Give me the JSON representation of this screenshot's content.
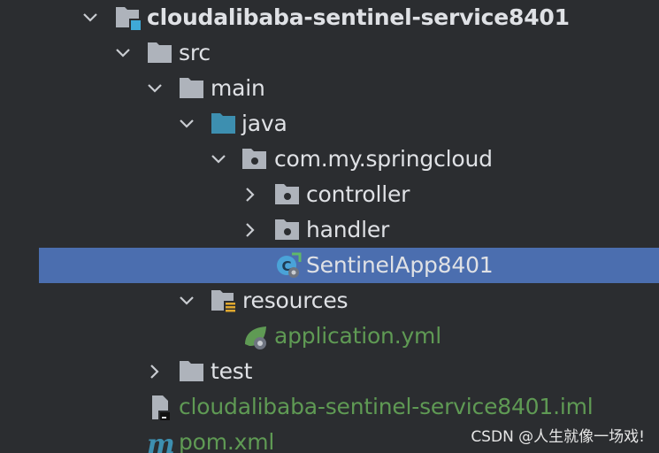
{
  "tree": {
    "items": [
      {
        "name": "cloudalibaba-sentinel-service8401",
        "type": "module",
        "expanded": true
      },
      {
        "name": "src",
        "type": "folder",
        "expanded": true
      },
      {
        "name": "main",
        "type": "folder",
        "expanded": true
      },
      {
        "name": "java",
        "type": "source-folder",
        "expanded": true
      },
      {
        "name": "com.my.springcloud",
        "type": "package",
        "expanded": true
      },
      {
        "name": "controller",
        "type": "package",
        "expanded": false
      },
      {
        "name": "handler",
        "type": "package",
        "expanded": false
      },
      {
        "name": "SentinelApp8401",
        "type": "spring-boot-class",
        "selected": true
      },
      {
        "name": "resources",
        "type": "resources-folder",
        "expanded": true
      },
      {
        "name": "application.yml",
        "type": "spring-config-file"
      },
      {
        "name": "test",
        "type": "folder",
        "expanded": false
      },
      {
        "name": "cloudalibaba-sentinel-service8401.iml",
        "type": "iml-file"
      },
      {
        "name": "pom.xml",
        "type": "maven-file"
      }
    ]
  },
  "watermark": "CSDN @人生就像一场戏!",
  "colors": {
    "background": "#2b2d30",
    "selection": "#4b6eaf",
    "text": "#dfe1e5",
    "green_text": "#5f9a54",
    "folder_gray": "#aeb3bb",
    "source_folder_blue": "#3d8fb0"
  }
}
